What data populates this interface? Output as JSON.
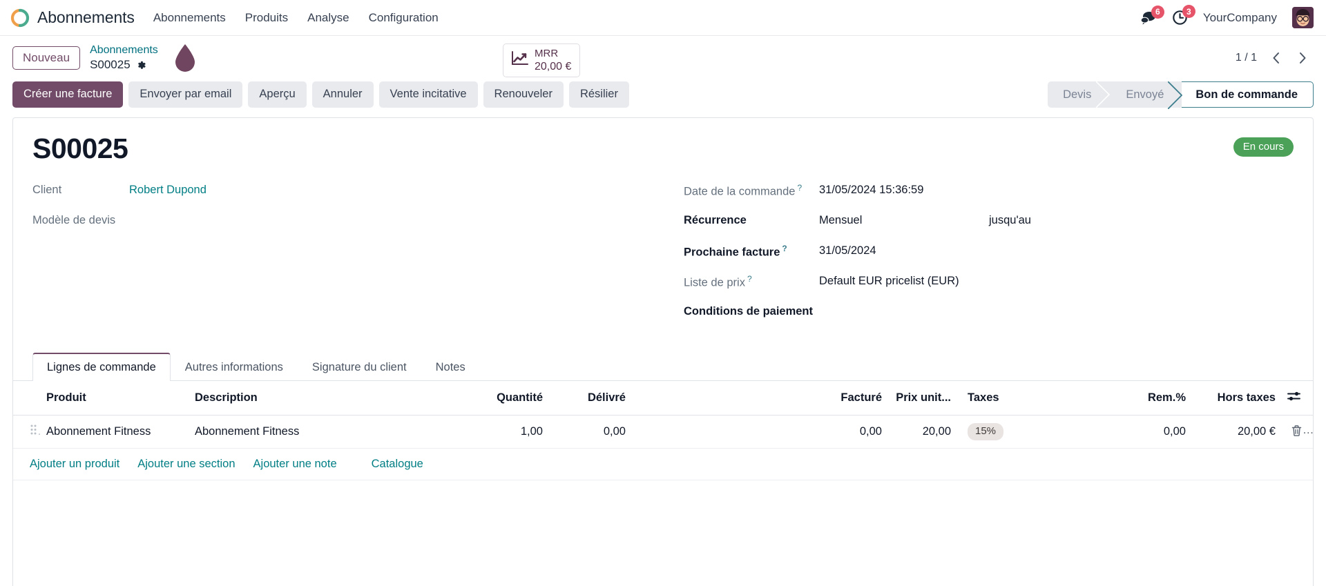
{
  "navbar": {
    "brand": "Abonnements",
    "menu": [
      {
        "label": "Abonnements"
      },
      {
        "label": "Produits"
      },
      {
        "label": "Analyse"
      },
      {
        "label": "Configuration"
      }
    ],
    "messages_icon": "messages-icon",
    "messages_count": "6",
    "activities_icon": "activities-clock-icon",
    "activities_count": "3",
    "company": "YourCompany",
    "avatar_icon": "user-avatar"
  },
  "control": {
    "new_button": "Nouveau",
    "breadcrumb_parent": "Abonnements",
    "breadcrumb_current": "S00025",
    "gear_icon": "gear-icon",
    "droplet_icon": "droplet-icon",
    "stat": {
      "icon": "line-chart-icon",
      "label": "MRR",
      "value": "20,00 €"
    },
    "pager": {
      "counter": "1 / 1",
      "prev_icon": "chevron-left-icon",
      "next_icon": "chevron-right-icon"
    }
  },
  "actions": {
    "primary": "Créer une facture",
    "secondary": [
      "Envoyer par email",
      "Aperçu",
      "Annuler",
      "Vente incitative",
      "Renouveler",
      "Résilier"
    ]
  },
  "statusbar": {
    "steps": [
      {
        "label": "Devis",
        "active": false
      },
      {
        "label": "Envoyé",
        "active": false
      },
      {
        "label": "Bon de commande",
        "active": true
      }
    ],
    "active_border_color": "#3b7d8c"
  },
  "record": {
    "title": "S00025",
    "ribbon": "En cours",
    "ribbon_color": "#4ba157"
  },
  "form": {
    "left": [
      {
        "label": "Client",
        "value": "Robert Dupond",
        "is_link": true,
        "bold": false,
        "help": false
      },
      {
        "label": "Modèle de devis",
        "value": "",
        "is_link": false,
        "bold": false,
        "help": false
      }
    ],
    "right": [
      {
        "label": "Date de la commande",
        "value": "31/05/2024 15:36:59",
        "bold": false,
        "help": true,
        "extra": ""
      },
      {
        "label": "Récurrence",
        "value": "Mensuel",
        "bold": true,
        "help": false,
        "extra": "jusqu'au"
      },
      {
        "label": "Prochaine facture",
        "value": "31/05/2024",
        "bold": true,
        "help": true,
        "extra": ""
      },
      {
        "label": "Liste de prix",
        "value": "Default EUR pricelist (EUR)",
        "bold": false,
        "help": true,
        "extra": ""
      },
      {
        "label": "Conditions de paiement",
        "value": "",
        "bold": true,
        "help": false,
        "extra": ""
      }
    ]
  },
  "notebook": {
    "tabs": [
      {
        "label": "Lignes de commande",
        "active": true
      },
      {
        "label": "Autres informations",
        "active": false
      },
      {
        "label": "Signature du client",
        "active": false
      },
      {
        "label": "Notes",
        "active": false
      }
    ]
  },
  "lines": {
    "headers": {
      "product": "Produit",
      "description": "Description",
      "quantity": "Quantité",
      "delivered": "Délivré",
      "invoiced": "Facturé",
      "unit_price": "Prix unit...",
      "taxes": "Taxes",
      "discount": "Rem.%",
      "subtotal": "Hors taxes",
      "options_icon": "column-options-icon"
    },
    "rows": [
      {
        "handle_icon": "drag-handle-icon",
        "product": "Abonnement Fitness",
        "description": "Abonnement Fitness",
        "quantity": "1,00",
        "delivered": "0,00",
        "invoiced": "0,00",
        "unit_price": "20,00",
        "taxes": "15%",
        "discount": "0,00",
        "subtotal": "20,00 €",
        "delete_icon": "trash-icon"
      }
    ],
    "add_links": [
      {
        "label": "Ajouter un produit",
        "kind": "product"
      },
      {
        "label": "Ajouter une section",
        "kind": "section"
      },
      {
        "label": "Ajouter une note",
        "kind": "note"
      },
      {
        "label": "Catalogue",
        "kind": "catalog"
      }
    ]
  },
  "theme": {
    "primary": "#714b67",
    "link": "#017e84",
    "accent_teal": "#00707f",
    "badge_red": "#e6546a"
  }
}
